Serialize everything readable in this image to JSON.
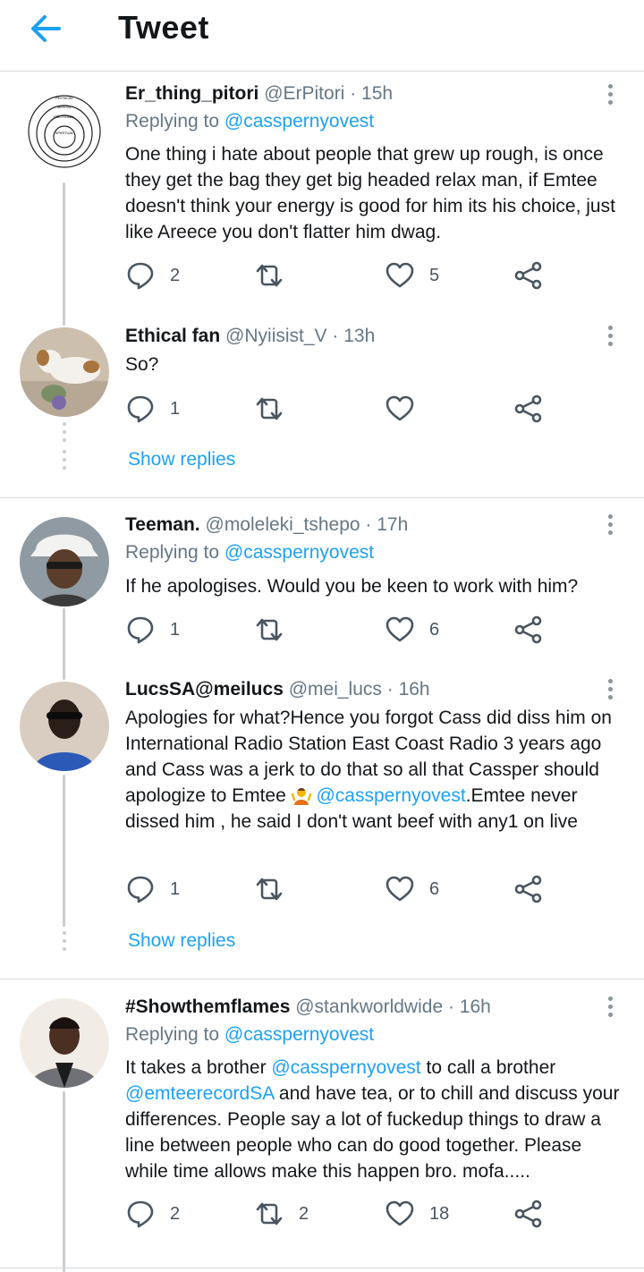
{
  "header": {
    "title": "Tweet"
  },
  "tweets": [
    {
      "name": "Er_thing_pitori",
      "handle": "@ErPitori",
      "time": "· 15h",
      "replying_prefix": "Replying to ",
      "replying_handle": "@casspernyovest",
      "text": "One thing i hate about people that grew up rough, is once they get the bag they get big headed relax man,  if Emtee doesn't think your energy is good for him its his choice, just like Areece you don't flatter him dwag.",
      "replies": "2",
      "retweets": "",
      "likes": "5",
      "avatar_labels": [
        "PHYSICAL",
        "MENTAL",
        "EMOTIONAL",
        "SPIRITUAL"
      ]
    },
    {
      "name": "Ethical fan",
      "handle": "@Nyiisist_V",
      "time": "· 13h",
      "text": "So?",
      "replies": "1",
      "retweets": "",
      "likes": ""
    },
    {
      "name": "Teeman.",
      "handle": "@moleleki_tshepo",
      "time": "· 17h",
      "replying_prefix": "Replying to ",
      "replying_handle": "@casspernyovest",
      "text": "If he apologises. Would you be keen to work with him?",
      "replies": "1",
      "retweets": "",
      "likes": "6"
    },
    {
      "name": "LucsSA@meilucs",
      "handle": "@mei_lucs",
      "time": "· 16h",
      "text_1": "Apologies for what?Hence you forgot Cass did diss him on International Radio Station East Coast Radio 3 years ago and Cass was a jerk to do that so all that Cassper should apologize to Emtee ",
      "mention": "@casspernyovest",
      "text_2": ".Emtee never dissed him , he said I don't want beef with any1 on live",
      "replies": "1",
      "retweets": "",
      "likes": "6"
    },
    {
      "name": "#Showthemflames",
      "handle": "@stankworldwide",
      "time": "· 16h",
      "replying_prefix": "Replying to ",
      "replying_handle": "@casspernyovest",
      "text_1": "It takes a brother ",
      "mention_1": "@casspernyovest",
      "text_2": " to call a brother ",
      "mention_2": "@emteerecordSA",
      "text_3": " and have tea, or to chill and discuss your differences. People say a lot of fuckedup things to draw a line between people who can do good together. Please while time allows make this happen bro. mofa.....",
      "replies": "2",
      "retweets": "2",
      "likes": "18"
    }
  ],
  "show_replies_label": "Show replies",
  "icons": {
    "back": "back-arrow-icon",
    "reply": "reply-icon",
    "retweet": "retweet-icon",
    "like": "heart-icon",
    "share": "share-icon",
    "more": "more-vertical-icon"
  },
  "colors": {
    "accent": "#1da1f2",
    "muted": "#657786",
    "divider": "#d6d9db"
  }
}
